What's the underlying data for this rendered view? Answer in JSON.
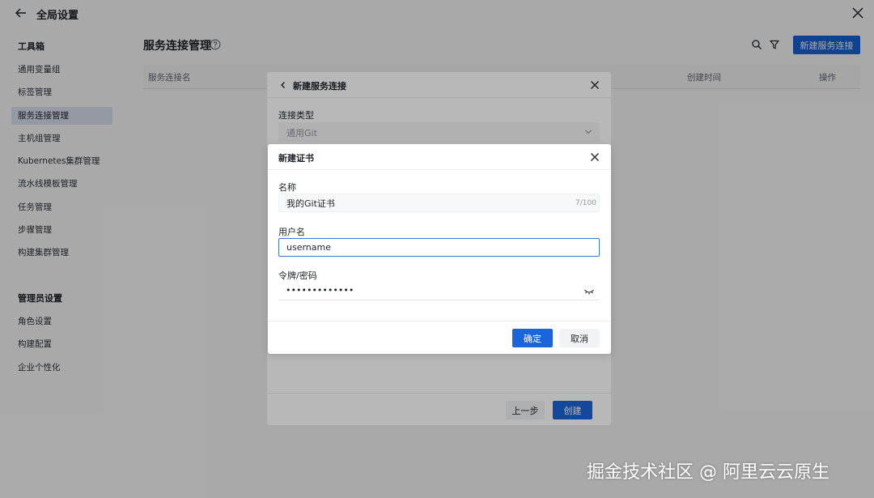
{
  "header": {
    "title": "全局设置"
  },
  "sidebar": {
    "toolbox_title": "工具箱",
    "toolbox_items": [
      {
        "label": "通用变量组"
      },
      {
        "label": "标签管理"
      },
      {
        "label": "服务连接管理"
      },
      {
        "label": "主机组管理"
      },
      {
        "label": "Kubernetes集群管理"
      },
      {
        "label": "流水线模板管理"
      },
      {
        "label": "任务管理"
      },
      {
        "label": "步骤管理"
      },
      {
        "label": "构建集群管理"
      }
    ],
    "admin_title": "管理员设置",
    "admin_items": [
      {
        "label": "角色设置"
      },
      {
        "label": "构建配置"
      },
      {
        "label": "企业个性化"
      }
    ]
  },
  "main": {
    "title": "服务连接管理",
    "new_button": "新建服务连接",
    "columns": {
      "name": "服务连接名",
      "created": "创建时间",
      "actions": "操作"
    }
  },
  "modal_service": {
    "title": "新建服务连接",
    "type_label": "连接类型",
    "type_value": "通用Git",
    "prev_label": "上一步",
    "create_label": "创建"
  },
  "modal_cert": {
    "title": "新建证书",
    "name_label": "名称",
    "name_value": "我的Git证书",
    "name_counter": "7/100",
    "username_label": "用户名",
    "username_value": "username",
    "password_label": "令牌/密码",
    "password_value": "•••••••••••••",
    "ok_label": "确定",
    "cancel_label": "取消"
  },
  "watermark": "掘金技术社区 @ 阿里云云原生",
  "colors": {
    "primary": "#1b64da",
    "active_menu_bg": "#dfe8f8"
  }
}
